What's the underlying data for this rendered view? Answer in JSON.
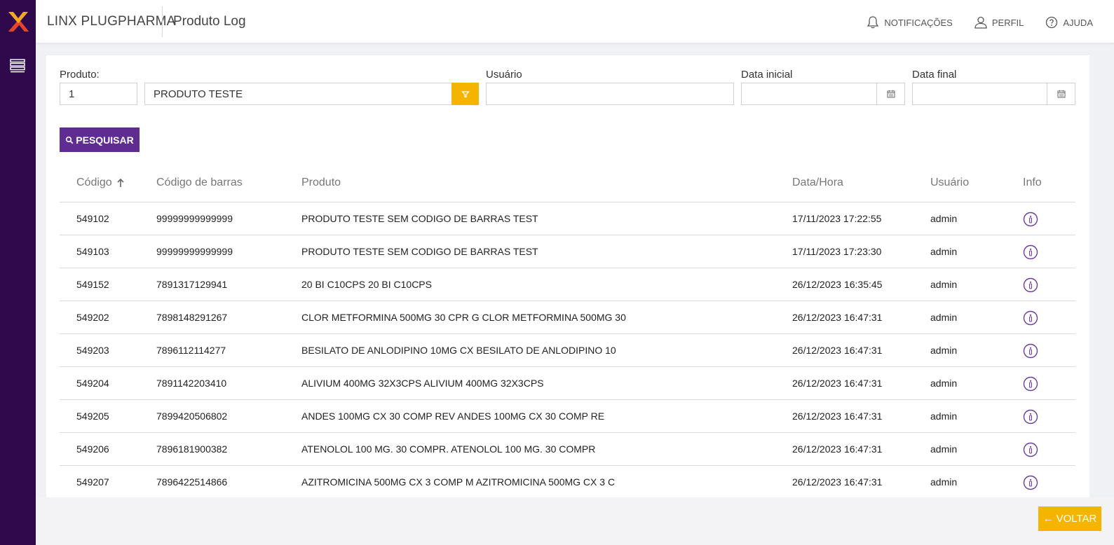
{
  "header": {
    "brand": "LINX PLUGPHARMA",
    "title": "Produto Log",
    "actions": [
      {
        "label": "NOTIFICAÇÕES",
        "icon": "bell-icon"
      },
      {
        "label": "PERFIL",
        "icon": "user-icon"
      },
      {
        "label": "AJUDA",
        "icon": "help-icon"
      }
    ]
  },
  "form": {
    "produto_label": "Produto:",
    "produto_code": "1",
    "produto_name": "PRODUTO TESTE",
    "usuario_label": "Usuário",
    "usuario_value": "",
    "data_inicial_label": "Data inicial",
    "data_inicial_value": "",
    "data_final_label": "Data final",
    "data_final_value": "",
    "search_label": "PESQUISAR"
  },
  "table": {
    "columns": [
      "Código",
      "Código de barras",
      "Produto",
      "Data/Hora",
      "Usuário",
      "Info"
    ],
    "rows": [
      {
        "codigo": "549102",
        "barras": "99999999999999",
        "produto": "PRODUTO TESTE SEM CODIGO DE BARRAS TEST",
        "data": "17/11/2023 17:22:55",
        "usuario": "admin"
      },
      {
        "codigo": "549103",
        "barras": "99999999999999",
        "produto": "PRODUTO TESTE SEM CODIGO DE BARRAS TEST",
        "data": "17/11/2023 17:23:30",
        "usuario": "admin"
      },
      {
        "codigo": "549152",
        "barras": "7891317129941",
        "produto": "20 BI C10CPS 20 BI C10CPS",
        "data": "26/12/2023 16:35:45",
        "usuario": "admin"
      },
      {
        "codigo": "549202",
        "barras": "7898148291267",
        "produto": "CLOR METFORMINA 500MG 30 CPR G CLOR METFORMINA 500MG 30",
        "data": "26/12/2023 16:47:31",
        "usuario": "admin"
      },
      {
        "codigo": "549203",
        "barras": "7896112114277",
        "produto": "BESILATO DE ANLODIPINO 10MG CX BESILATO DE ANLODIPINO 10",
        "data": "26/12/2023 16:47:31",
        "usuario": "admin"
      },
      {
        "codigo": "549204",
        "barras": "7891142203410",
        "produto": "ALIVIUM 400MG 32X3CPS ALIVIUM 400MG 32X3CPS",
        "data": "26/12/2023 16:47:31",
        "usuario": "admin"
      },
      {
        "codigo": "549205",
        "barras": "7899420506802",
        "produto": "ANDES 100MG CX 30 COMP REV ANDES 100MG CX 30 COMP RE",
        "data": "26/12/2023 16:47:31",
        "usuario": "admin"
      },
      {
        "codigo": "549206",
        "barras": "7896181900382",
        "produto": "ATENOLOL 100 MG. 30 COMPR. ATENOLOL 100 MG. 30 COMPR",
        "data": "26/12/2023 16:47:31",
        "usuario": "admin"
      },
      {
        "codigo": "549207",
        "barras": "7896422514866",
        "produto": "AZITROMICINA 500MG CX 3 COMP M AZITROMICINA 500MG CX 3 C",
        "data": "26/12/2023 16:47:31",
        "usuario": "admin"
      }
    ]
  },
  "footer": {
    "back_label": "VOLTAR"
  },
  "colors": {
    "sidebar": "#2e0a4d",
    "primary": "#5f2c92",
    "accent": "#f5b400",
    "info_icon": "#6a3aa0"
  }
}
